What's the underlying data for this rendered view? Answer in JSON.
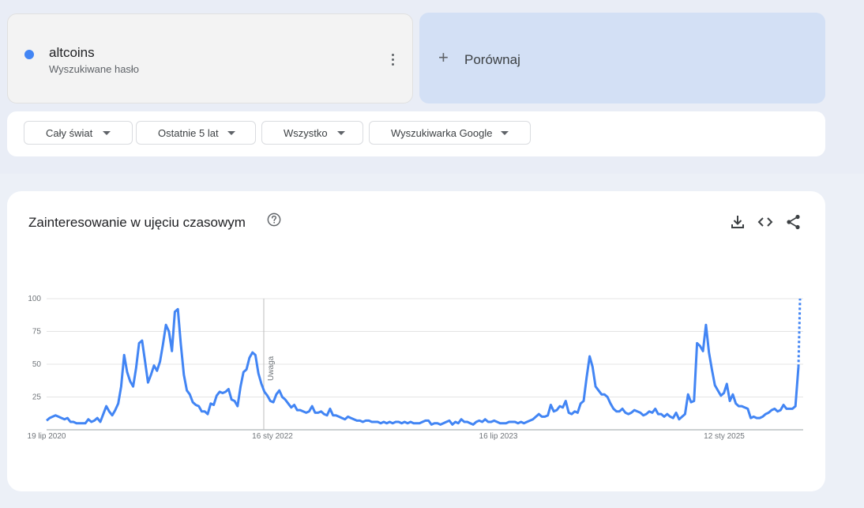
{
  "search_term": {
    "name": "altcoins",
    "subtitle": "Wyszukiwane hasło",
    "color": "#4285f4"
  },
  "compare": {
    "label": "Porównaj",
    "icon": "plus-icon"
  },
  "filters": [
    {
      "label": "Cały świat"
    },
    {
      "label": "Ostatnie 5 lat"
    },
    {
      "label": "Wszystko"
    },
    {
      "label": "Wyszukiwarka Google"
    }
  ],
  "chart_section": {
    "title": "Zainteresowanie w ujęciu czasowym",
    "icons": [
      "help-icon",
      "download-icon",
      "embed-icon",
      "share-icon"
    ]
  },
  "chart_data": {
    "type": "line",
    "x_labels": [
      "19 lip 2020",
      "16 sty 2022",
      "16 lip 2023",
      "12 sty 2025"
    ],
    "y_ticks": [
      25,
      50,
      75,
      100
    ],
    "ylim": [
      0,
      100
    ],
    "annotation": "Uwaga",
    "grid": true,
    "series": [
      {
        "color": "#4285f4",
        "values": [
          7,
          9,
          10,
          11,
          10,
          9,
          8,
          9,
          6,
          6,
          5,
          5,
          5,
          5,
          8,
          6,
          7,
          9,
          6,
          12,
          18,
          14,
          11,
          15,
          20,
          33,
          57,
          44,
          37,
          33,
          47,
          66,
          68,
          52,
          36,
          42,
          49,
          45,
          52,
          65,
          80,
          75,
          60,
          90,
          92,
          65,
          42,
          30,
          27,
          21,
          19,
          18,
          14,
          14,
          12,
          20,
          19,
          26,
          29,
          28,
          29,
          31,
          23,
          22,
          18,
          33,
          44,
          46,
          55,
          59,
          57,
          43,
          35,
          29,
          26,
          22,
          21,
          27,
          30,
          25,
          23,
          20,
          17,
          19,
          15,
          15,
          14,
          13,
          14,
          18,
          13,
          13,
          14,
          12,
          11,
          16,
          11,
          11,
          10,
          9,
          8,
          10,
          9,
          8,
          7,
          7,
          6,
          7,
          7,
          6,
          6,
          6,
          5,
          6,
          5,
          6,
          5,
          6,
          6,
          5,
          6,
          5,
          6,
          5,
          5,
          5,
          6,
          7,
          7,
          4,
          5,
          5,
          4,
          5,
          6,
          7,
          4,
          6,
          5,
          8,
          6,
          6,
          5,
          4,
          6,
          7,
          6,
          8,
          6,
          6,
          7,
          6,
          5,
          5,
          5,
          6,
          6,
          6,
          5,
          6,
          5,
          6,
          7,
          8,
          10,
          12,
          10,
          10,
          11,
          19,
          14,
          15,
          18,
          17,
          22,
          13,
          12,
          14,
          13,
          20,
          22,
          40,
          56,
          48,
          33,
          30,
          27,
          27,
          25,
          20,
          16,
          14,
          14,
          16,
          13,
          12,
          13,
          15,
          14,
          13,
          11,
          12,
          14,
          13,
          16,
          12,
          12,
          10,
          12,
          10,
          9,
          13,
          8,
          10,
          12,
          27,
          21,
          22,
          66,
          64,
          60,
          80,
          59,
          46,
          34,
          30,
          26,
          28,
          35,
          22,
          27,
          20,
          18,
          18,
          17,
          16,
          9,
          10,
          9,
          9,
          10,
          12,
          13,
          15,
          16,
          14,
          15,
          19,
          16,
          16,
          16,
          18,
          48
        ]
      }
    ],
    "partial_last_value": 100
  }
}
